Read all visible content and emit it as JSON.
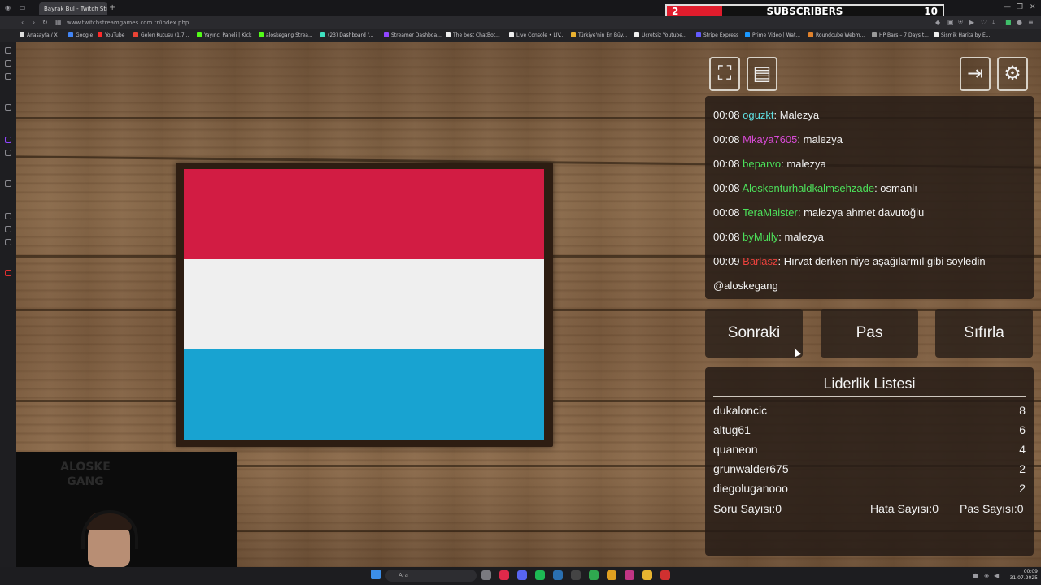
{
  "browser": {
    "tab_title": "Bayrak Bul - Twitch Stre...",
    "url": "www.twitchstreamgames.com.tr/index.php",
    "bookmarks": [
      "Anasayfa / X",
      "Google",
      "YouTube",
      "Gelen Kutusu (1.7...",
      "Yayıncı Paneli | Kick",
      "aloskegang Strea...",
      "(23) Dashboard /...",
      "Streamer Dashboa...",
      "The best ChatBot...",
      "Live Console • LIV...",
      "Türkiye'nin En Büy...",
      "Ücretsiz Youtube...",
      "Stripe Express",
      "Prime Video | Wat...",
      "Roundcube Webm...",
      "HP Bars – 7 Days t...",
      "Sismik Harita by E..."
    ]
  },
  "overlay": {
    "subs_current": "2",
    "subs_label": "SUBSCRIBERS",
    "subs_goal": "10",
    "subs_progress": 0.2,
    "cam_logo_line1": "ALOSKE",
    "cam_logo_line2": "GANG"
  },
  "flag": {
    "stripes": [
      "#d21c43",
      "#efefef",
      "#18a3d1"
    ]
  },
  "toolbar": {
    "fullscreen_icon": "⛶",
    "list_icon": "▤",
    "exit_icon": "⇥",
    "settings_icon": "⚙"
  },
  "chat": {
    "messages": [
      {
        "time": "00:08",
        "user": "oguzkt",
        "color": "#5fe0e3",
        "text": ": Malezya"
      },
      {
        "time": "00:08",
        "user": "Mkaya7605",
        "color": "#d84bd6",
        "text": ": malezya"
      },
      {
        "time": "00:08",
        "user": "beparvo",
        "color": "#4ce05a",
        "text": ": malezya"
      },
      {
        "time": "00:08",
        "user": "Aloskenturhaldkalmsehzade",
        "color": "#4ce05a",
        "text": ": osmanlı"
      },
      {
        "time": "00:08",
        "user": "TeraMaister",
        "color": "#4ce05a",
        "text": ": malezya ahmet davutoğlu"
      },
      {
        "time": "00:08",
        "user": "byMully",
        "color": "#4ce05a",
        "text": ": malezya"
      },
      {
        "time": "00:09",
        "user": "Barlasz",
        "color": "#e8413c",
        "text": ": Hırvat derken niye aşağılarmıl gibi söyledin"
      }
    ],
    "continuation": "@aloskegang"
  },
  "buttons": {
    "next": "Sonraki",
    "pass": "Pas",
    "reset": "Sıfırla"
  },
  "leaderboard": {
    "title": "Liderlik Listesi",
    "rows": [
      {
        "name": "dukaloncic",
        "score": "8"
      },
      {
        "name": "altug61",
        "score": "6"
      },
      {
        "name": "quaneon",
        "score": "4"
      },
      {
        "name": "grunwalder675",
        "score": "2"
      },
      {
        "name": "diegoluganooo",
        "score": "2"
      }
    ],
    "question_count": "Soru Sayısı:0",
    "error_count": "Hata Sayısı:0",
    "pass_count": "Pas Sayısı:0"
  },
  "taskbar": {
    "search_placeholder": "Ara",
    "time": "00:09",
    "date": "31.07.2025"
  }
}
